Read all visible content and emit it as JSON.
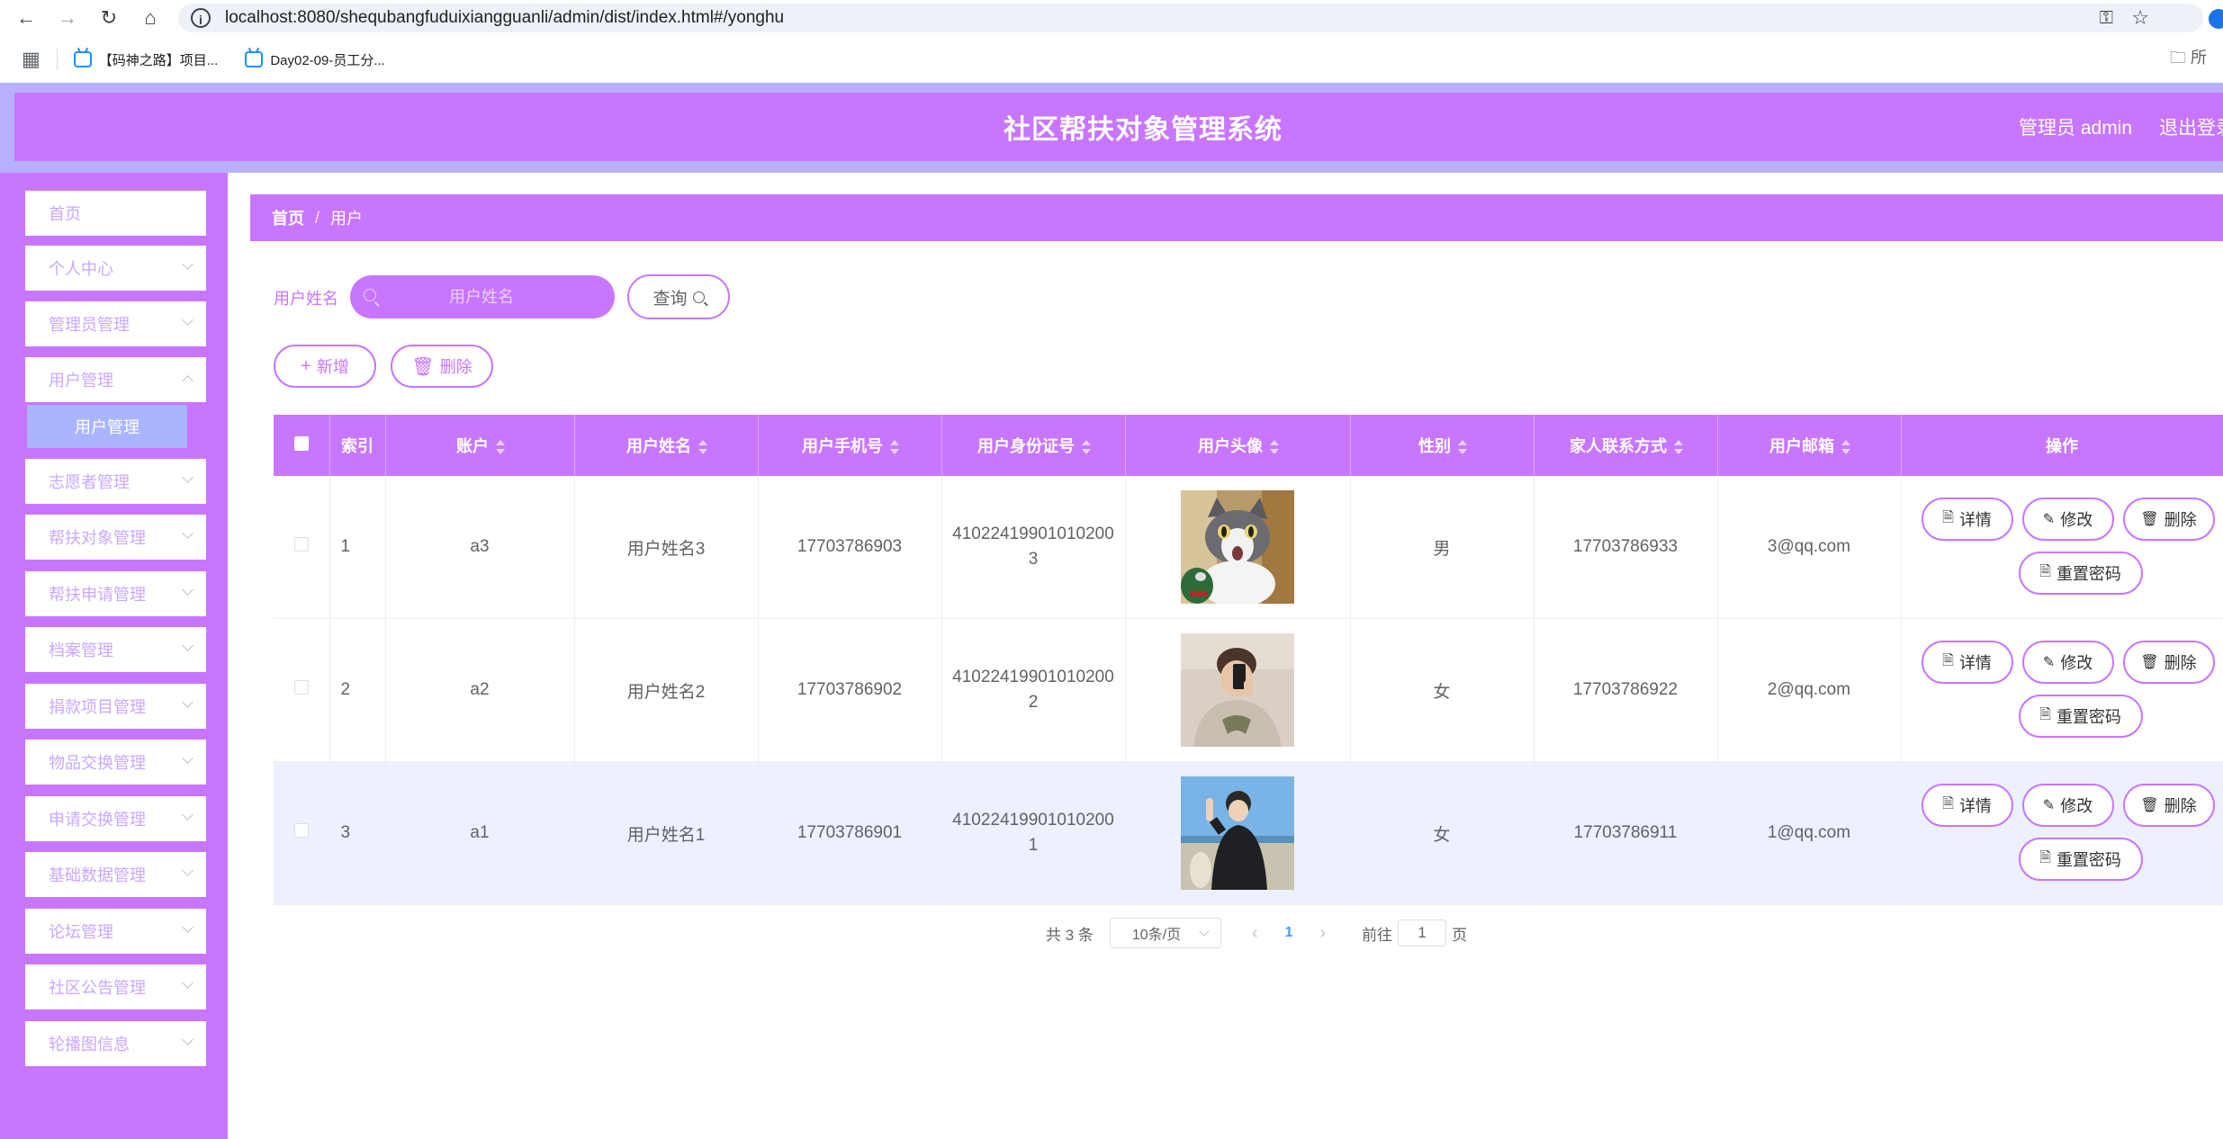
{
  "browser": {
    "url": "localhost:8080/shequbangfuduixiangguanli/admin/dist/index.html#/yonghu",
    "bookmarks": [
      "【码神之路】项目...",
      "Day02-09-员工分..."
    ],
    "bookmark_folder": "所"
  },
  "header": {
    "title": "社区帮扶对象管理系统",
    "user": "管理员 admin",
    "logout": "退出登录"
  },
  "sidebar": {
    "items": [
      {
        "label": "首页",
        "has_chevron": false
      },
      {
        "label": "个人中心",
        "has_chevron": true
      },
      {
        "label": "管理员管理",
        "has_chevron": true
      },
      {
        "label": "用户管理",
        "has_chevron": true,
        "open": true
      },
      {
        "label": "志愿者管理",
        "has_chevron": true
      },
      {
        "label": "帮扶对象管理",
        "has_chevron": true
      },
      {
        "label": "帮扶申请管理",
        "has_chevron": true
      },
      {
        "label": "档案管理",
        "has_chevron": true
      },
      {
        "label": "捐款项目管理",
        "has_chevron": true
      },
      {
        "label": "物品交换管理",
        "has_chevron": true
      },
      {
        "label": "申请交换管理",
        "has_chevron": true
      },
      {
        "label": "基础数据管理",
        "has_chevron": true
      },
      {
        "label": "论坛管理",
        "has_chevron": true
      },
      {
        "label": "社区公告管理",
        "has_chevron": true
      },
      {
        "label": "轮播图信息",
        "has_chevron": true
      }
    ],
    "active_sub": "用户管理"
  },
  "breadcrumb": {
    "home": "首页",
    "separator": "/",
    "current": "用户"
  },
  "search": {
    "label": "用户姓名",
    "placeholder": "用户姓名",
    "button": "查询"
  },
  "actions": {
    "add": "新增",
    "delete": "删除"
  },
  "table": {
    "columns": [
      "索引",
      "账户",
      "用户姓名",
      "用户手机号",
      "用户身份证号",
      "用户头像",
      "性别",
      "家人联系方式",
      "用户邮箱",
      "操作"
    ],
    "rows": [
      {
        "index": "1",
        "account": "a3",
        "name": "用户姓名3",
        "phone": "17703786903",
        "id_card": "410224199010102003",
        "avatar": "cat",
        "gender": "男",
        "family_phone": "17703786933",
        "email": "3@qq.com"
      },
      {
        "index": "2",
        "account": "a2",
        "name": "用户姓名2",
        "phone": "17703786902",
        "id_card": "410224199010102002",
        "avatar": "mirror-selfie",
        "gender": "女",
        "family_phone": "17703786922",
        "email": "2@qq.com"
      },
      {
        "index": "3",
        "account": "a1",
        "name": "用户姓名1",
        "phone": "17703786901",
        "id_card": "410224199010102001",
        "avatar": "beach-portrait",
        "gender": "女",
        "family_phone": "17703786911",
        "email": "1@qq.com"
      }
    ],
    "row_actions": {
      "detail": "详情",
      "edit": "修改",
      "delete": "删除",
      "reset": "重置密码"
    }
  },
  "pagination": {
    "total": "共 3 条",
    "page_size": "10条/页",
    "current_page": "1",
    "goto_prefix": "前往",
    "goto_value": "1",
    "goto_suffix": "页"
  },
  "colors": {
    "accent": "#c876ff",
    "sidebar_sub": "#a9b6ff",
    "header_band": "#b8b0ff",
    "highlight_row": "#ecf0ff",
    "page_link": "#409eff"
  }
}
